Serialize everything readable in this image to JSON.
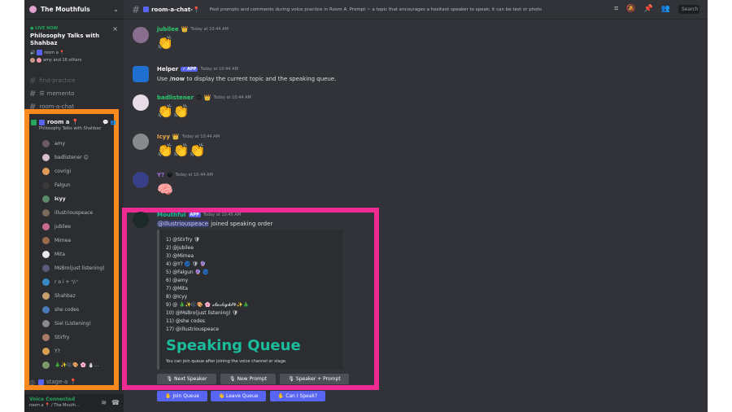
{
  "server": {
    "name": "The Mouthfuls"
  },
  "live": {
    "badge": "LIVE NOW",
    "title": "Philosophy Talks with Shahbaz",
    "channel": "room a 📍",
    "members": "amy and 16 others"
  },
  "channels": {
    "partial": "find-practice",
    "memento": "memento",
    "partial2": "room-a-chat"
  },
  "voice_channel": {
    "name": "room a 📍",
    "subtitle": "Philosophy Talks with Shahbaz",
    "members": [
      "amy",
      "badlistener 😊",
      "covrigi",
      "Falgun",
      "Icyy",
      "illustriouspeace",
      "jubilee",
      "Mimea",
      "Mita",
      "MsBro(just listening)",
      "r o i + ⁿ/ᵣ⁺",
      "Shahbaz",
      "she codes",
      "Siel (Listening)",
      "Stirfry",
      "Y?",
      "🎄✨🎼🎨 🌸 ⛄..."
    ],
    "next": "stage-a 📍"
  },
  "voice_bar": {
    "status": "Voice Connected",
    "location": "room a 📍 / The Mouth..."
  },
  "topbar": {
    "channel": "room-a-chat-📍",
    "topic": "Post prompts and comments during voice practice in Room A. Prompt ~ a topic that encourages a hesitant speaker to speak; it can be text or photo",
    "search": "Search"
  },
  "messages": [
    {
      "author": "jubilee",
      "crown": "👑",
      "time": "Today at 10:44 AM",
      "color": "#2dc770",
      "emoji": "👏"
    },
    {
      "author": "Helper",
      "tag": "✓ APP",
      "time": "Today at 10:44 AM",
      "color": "#f2f3f5",
      "text_before": "Use ",
      "command": "/now",
      "text_after": " to display the current topic and the speaking queue."
    },
    {
      "author": "badlistener",
      "extra": "😊 👑",
      "time": "Today at 10:44 AM",
      "color": "#2dc770",
      "emoji": "👏👏"
    },
    {
      "author": "Icyy",
      "crown": "👑",
      "time": "Today at 10:44 AM",
      "color": "#e8a54b",
      "emoji": "👏👏👏"
    },
    {
      "author": "Y?",
      "extra": "😀",
      "time": "Today at 10:44 AM",
      "color": "#a66bd6",
      "emoji": "🧠"
    }
  ],
  "queue_message": {
    "author": "Mouthful",
    "tag": "APP",
    "time": "Today at 10:45 AM",
    "mention": "@illustriouspeace",
    "action": " joined speaking order",
    "queue": [
      "1) @Stirfry 🛡",
      "2) @jubilee",
      "3) @Mimea",
      "4) @Y? 🌀 🛡 🔮",
      "5) @Falgun 🔮 🌀",
      "6) @amy",
      "7) @Mita",
      "8) @Icyy",
      "9) @ 🎄✨🎼🎨 🌸 𝓼𝓽𝓪𝓻𝓵𝓲𝓰𝓱𝓽❄✨🎄",
      "10) @MsBro(just listening) 🛡",
      "11) @she codes",
      "17) @illustriouspeace"
    ],
    "title": "Speaking Queue",
    "footer": "You can join queue after joining the voice channel or stage.",
    "buttons": [
      "Next Speaker",
      "New Prompt",
      "Speaker + Prompt"
    ],
    "buttons2": [
      "Join Queue",
      "Leave Queue",
      "Can I Speak?"
    ]
  },
  "colors": {
    "orange": "#fb8a1e",
    "pink": "#ee2a93",
    "teal": "#1abc9c",
    "blurple": "#5865f2"
  }
}
